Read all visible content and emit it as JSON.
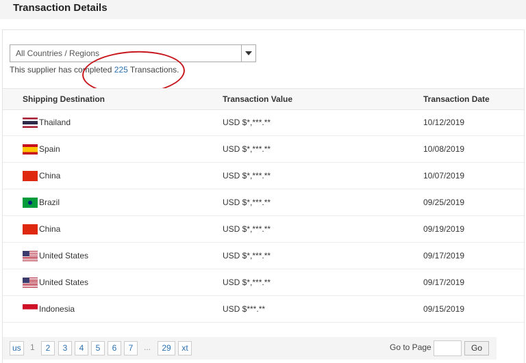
{
  "title": "Transaction Details",
  "filter": {
    "selected": "All Countries / Regions"
  },
  "summary": {
    "prefix": "This supplier has completed",
    "count": "225",
    "suffix": "Transactions."
  },
  "columns": [
    "Shipping Destination",
    "Transaction Value",
    "Transaction Date"
  ],
  "rows": [
    {
      "country": "Thailand",
      "flag": "thailand",
      "value": "USD $*,***.**",
      "date": "10/12/2019"
    },
    {
      "country": "Spain",
      "flag": "spain",
      "value": "USD $*,***.**",
      "date": "10/08/2019"
    },
    {
      "country": "China",
      "flag": "china",
      "value": "USD $*,***.**",
      "date": "10/07/2019"
    },
    {
      "country": "Brazil",
      "flag": "brazil",
      "value": "USD $*,***.**",
      "date": "09/25/2019"
    },
    {
      "country": "China",
      "flag": "china",
      "value": "USD $*,***.**",
      "date": "09/19/2019"
    },
    {
      "country": "United States",
      "flag": "us",
      "value": "USD $*,***.**",
      "date": "09/17/2019"
    },
    {
      "country": "United States",
      "flag": "us",
      "value": "USD $*,***.**",
      "date": "09/17/2019"
    },
    {
      "country": "Indonesia",
      "flag": "indonesia",
      "value": "USD $***.**",
      "date": "09/15/2019"
    }
  ],
  "pagination": {
    "prev": "us",
    "current": "1",
    "pages": [
      "2",
      "3",
      "4",
      "5",
      "6",
      "7"
    ],
    "ellipsis": "...",
    "last": "29",
    "next": "xt",
    "goto_label": "Go to Page",
    "goto_value": "",
    "go_label": "Go"
  }
}
